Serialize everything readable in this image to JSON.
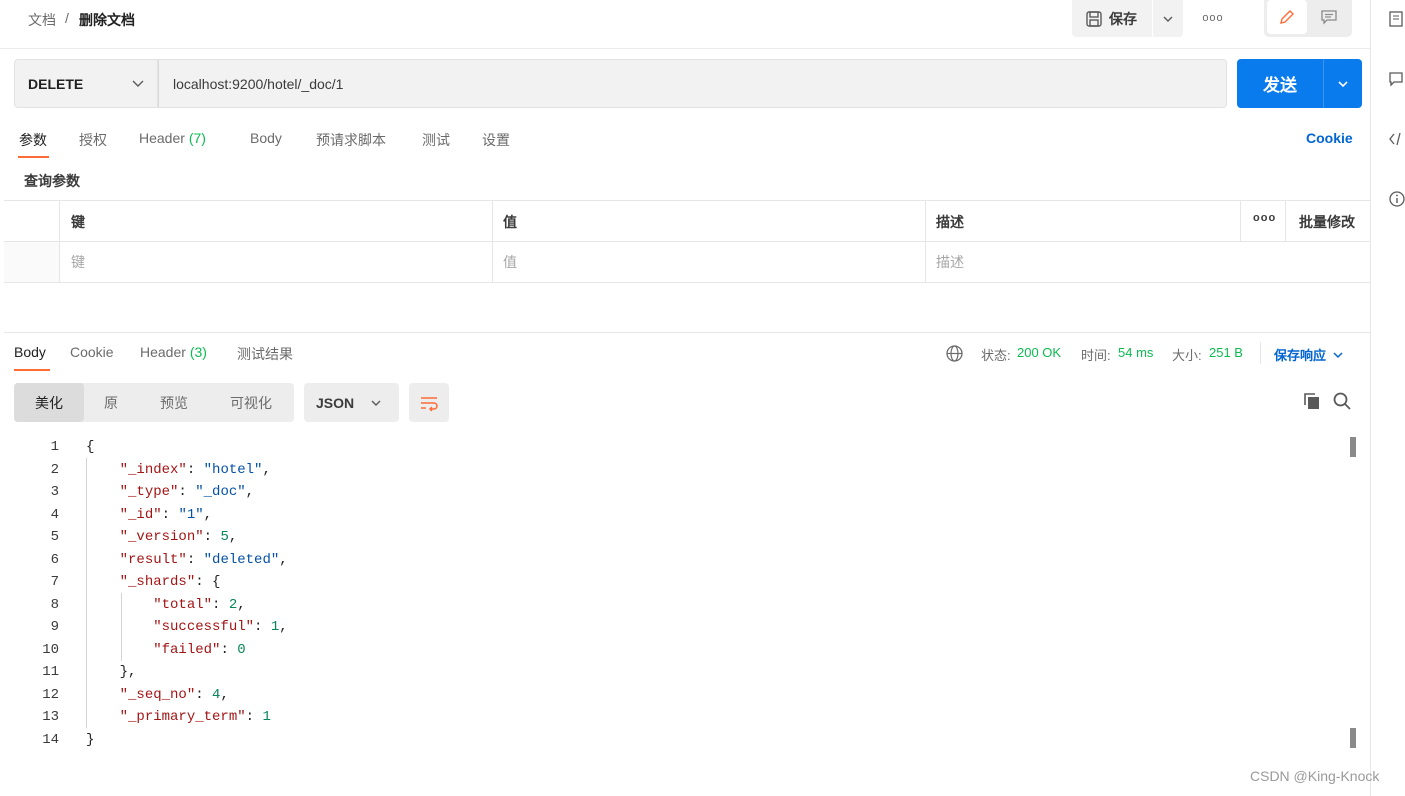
{
  "breadcrumb": {
    "parent": "文档",
    "separator": "/",
    "current": "删除文档"
  },
  "toolbar": {
    "save_label": "保存",
    "more_label": "ooo"
  },
  "request": {
    "method": "DELETE",
    "url": "localhost:9200/hotel/_doc/1",
    "send_label": "发送"
  },
  "request_tabs": [
    {
      "label": "参数"
    },
    {
      "label": "授权"
    },
    {
      "label": "Header",
      "count": "(7)"
    },
    {
      "label": "Body"
    },
    {
      "label": "预请求脚本"
    },
    {
      "label": "测试"
    },
    {
      "label": "设置"
    }
  ],
  "cookie_label": "Cookie",
  "query_params": {
    "title": "查询参数",
    "headers": {
      "key": "键",
      "value": "值",
      "description": "描述",
      "more": "ooo",
      "bulk_edit": "批量修改"
    },
    "placeholders": {
      "key": "键",
      "value": "值",
      "description": "描述"
    }
  },
  "response_tabs": [
    {
      "label": "Body"
    },
    {
      "label": "Cookie"
    },
    {
      "label": "Header",
      "count": "(3)"
    },
    {
      "label": "测试结果"
    }
  ],
  "response_status": {
    "status_label": "状态:",
    "status_value": "200 OK",
    "time_label": "时间:",
    "time_value": "54 ms",
    "size_label": "大小:",
    "size_value": "251 B",
    "save_response": "保存响应"
  },
  "view_modes": [
    "美化",
    "原",
    "预览",
    "可视化"
  ],
  "format": "JSON",
  "code_lines": [
    {
      "n": "1",
      "indent": 0,
      "parts": [
        [
          "p",
          "{"
        ]
      ]
    },
    {
      "n": "2",
      "indent": 1,
      "parts": [
        [
          "k",
          "\"_index\""
        ],
        [
          "p",
          ": "
        ],
        [
          "s",
          "\"hotel\""
        ],
        [
          "p",
          ","
        ]
      ]
    },
    {
      "n": "3",
      "indent": 1,
      "parts": [
        [
          "k",
          "\"_type\""
        ],
        [
          "p",
          ": "
        ],
        [
          "s",
          "\"_doc\""
        ],
        [
          "p",
          ","
        ]
      ]
    },
    {
      "n": "4",
      "indent": 1,
      "parts": [
        [
          "k",
          "\"_id\""
        ],
        [
          "p",
          ": "
        ],
        [
          "s",
          "\"1\""
        ],
        [
          "p",
          ","
        ]
      ]
    },
    {
      "n": "5",
      "indent": 1,
      "parts": [
        [
          "k",
          "\"_version\""
        ],
        [
          "p",
          ": "
        ],
        [
          "n",
          "5"
        ],
        [
          "p",
          ","
        ]
      ]
    },
    {
      "n": "6",
      "indent": 1,
      "parts": [
        [
          "k",
          "\"result\""
        ],
        [
          "p",
          ": "
        ],
        [
          "s",
          "\"deleted\""
        ],
        [
          "p",
          ","
        ]
      ]
    },
    {
      "n": "7",
      "indent": 1,
      "parts": [
        [
          "k",
          "\"_shards\""
        ],
        [
          "p",
          ": {"
        ]
      ]
    },
    {
      "n": "8",
      "indent": 2,
      "parts": [
        [
          "k",
          "\"total\""
        ],
        [
          "p",
          ": "
        ],
        [
          "n",
          "2"
        ],
        [
          "p",
          ","
        ]
      ]
    },
    {
      "n": "9",
      "indent": 2,
      "parts": [
        [
          "k",
          "\"successful\""
        ],
        [
          "p",
          ": "
        ],
        [
          "n",
          "1"
        ],
        [
          "p",
          ","
        ]
      ]
    },
    {
      "n": "10",
      "indent": 2,
      "parts": [
        [
          "k",
          "\"failed\""
        ],
        [
          "p",
          ": "
        ],
        [
          "n",
          "0"
        ]
      ]
    },
    {
      "n": "11",
      "indent": 1,
      "parts": [
        [
          "p",
          "},"
        ]
      ]
    },
    {
      "n": "12",
      "indent": 1,
      "parts": [
        [
          "k",
          "\"_seq_no\""
        ],
        [
          "p",
          ": "
        ],
        [
          "n",
          "4"
        ],
        [
          "p",
          ","
        ]
      ]
    },
    {
      "n": "13",
      "indent": 1,
      "parts": [
        [
          "k",
          "\"_primary_term\""
        ],
        [
          "p",
          ": "
        ],
        [
          "n",
          "1"
        ]
      ]
    },
    {
      "n": "14",
      "indent": 0,
      "parts": [
        [
          "p",
          "}"
        ]
      ]
    }
  ],
  "watermark": "CSDN @King-Knock",
  "colors": {
    "accent": "#ff6c37",
    "primary": "#097bed",
    "success": "#0cbb52",
    "link": "#0265d2"
  }
}
